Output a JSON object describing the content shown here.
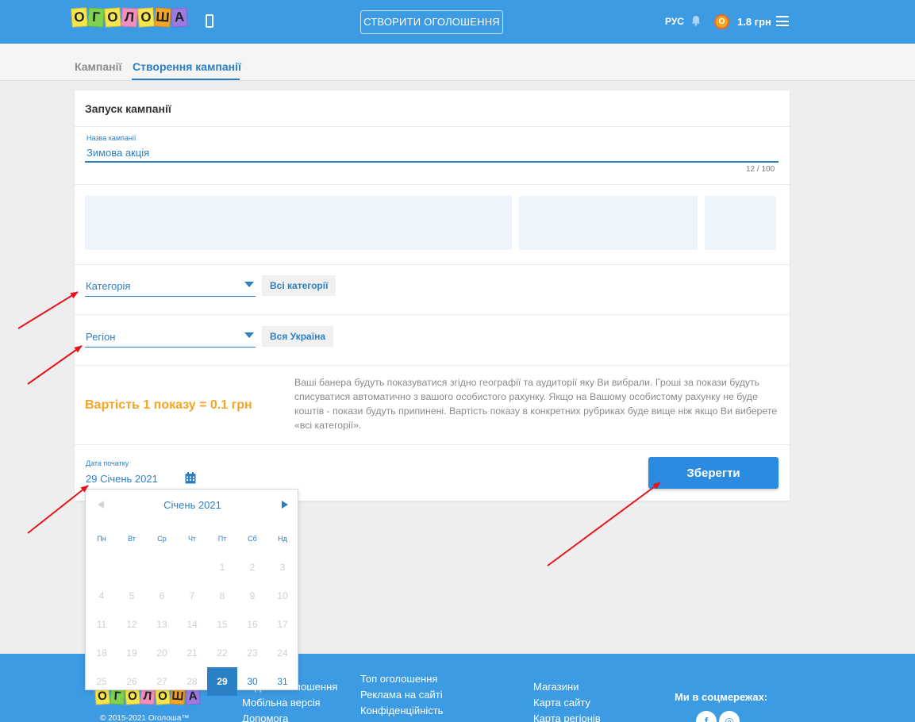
{
  "header": {
    "logo_letters": [
      "О",
      "Г",
      "О",
      "Л",
      "О",
      "Ш",
      "А"
    ],
    "logo_colors": [
      "#f7e64b",
      "#7ed24f",
      "#f7e64b",
      "#f28fbf",
      "#f7e64b",
      "#f5a524",
      "#9c7be0"
    ],
    "create_button": "СТВОРИТИ ОГОЛОШЕННЯ",
    "language": "РУС",
    "coin_letter": "О",
    "balance": "1.8 грн"
  },
  "tabs": [
    {
      "label": "Кампанії"
    },
    {
      "label": "Створення кампанії"
    }
  ],
  "card": {
    "title": "Запуск кампанії",
    "name_label": "Назва кампанії",
    "name_value": "Зимова акція",
    "name_counter": "12 / 100",
    "category_placeholder": "Категорія",
    "category_chip": "Всі категорії",
    "region_placeholder": "Регіон",
    "region_chip": "Вся Україна",
    "price": "Вартість 1 показу = 0.1 грн",
    "notice": "Ваші банера будуть показуватися згідно географії та аудиторії яку Ви вибрали. Гроші за покази будуть списуватися автоматично з вашого особистого рахунку. Якщо на Вашому особистому рахунку не буде коштів - покази будуть припинені. Вартість показу в конкретних рубриках буде вище ніж якщо Ви виберете «всі категорії».",
    "date_label": "Дата початку",
    "date_value": "29 Січень 2021",
    "save_button": "Зберегти"
  },
  "datepicker": {
    "title": "Січень 2021",
    "weekdays": [
      "Пн",
      "Вт",
      "Ср",
      "Чт",
      "Пт",
      "Сб",
      "Нд"
    ],
    "rows": [
      [
        "",
        "",
        "",
        "",
        "1",
        "2",
        "3"
      ],
      [
        "4",
        "5",
        "6",
        "7",
        "8",
        "9",
        "10"
      ],
      [
        "11",
        "12",
        "13",
        "14",
        "15",
        "16",
        "17"
      ],
      [
        "18",
        "19",
        "20",
        "21",
        "22",
        "23",
        "24"
      ],
      [
        "25",
        "26",
        "27",
        "28",
        "29",
        "30",
        "31"
      ]
    ],
    "selected": "29",
    "available": [
      "30",
      "31"
    ]
  },
  "footer": {
    "col1": [
      "Подати оголошення",
      "Мобільна версія",
      "Допомога"
    ],
    "col2": [
      "Топ оголошення",
      "Реклама на сайті",
      "Конфіденційність"
    ],
    "col3": [
      "Магазини",
      "Карта сайту",
      "Карта регіонів"
    ],
    "social_title": "Ми в соцмережах:",
    "social_icons": [
      "f",
      "◎"
    ],
    "copyright": "© 2015-2021 Оголоша™"
  },
  "colors": {
    "primary": "#2b7fc4",
    "header_bg": "#3d9be3",
    "accent_orange": "#f5a524",
    "annotation_red": "#e8141b"
  }
}
